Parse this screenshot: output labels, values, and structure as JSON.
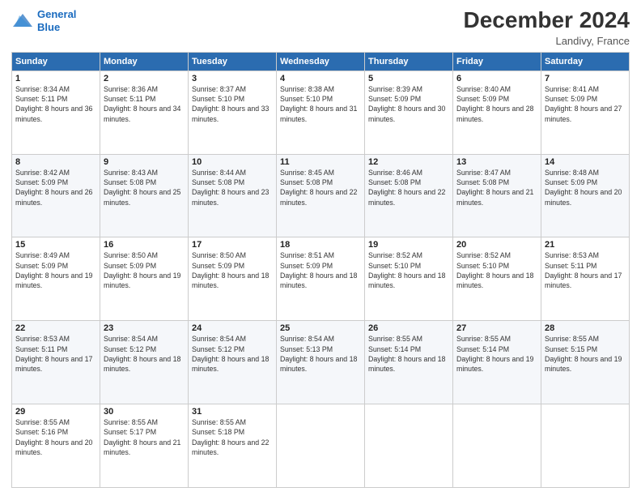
{
  "logo": {
    "line1": "General",
    "line2": "Blue"
  },
  "header": {
    "title": "December 2024",
    "subtitle": "Landivy, France"
  },
  "weekdays": [
    "Sunday",
    "Monday",
    "Tuesday",
    "Wednesday",
    "Thursday",
    "Friday",
    "Saturday"
  ],
  "weeks": [
    [
      {
        "day": "1",
        "sunrise": "8:34 AM",
        "sunset": "5:11 PM",
        "daylight": "8 hours and 36 minutes."
      },
      {
        "day": "2",
        "sunrise": "8:36 AM",
        "sunset": "5:11 PM",
        "daylight": "8 hours and 34 minutes."
      },
      {
        "day": "3",
        "sunrise": "8:37 AM",
        "sunset": "5:10 PM",
        "daylight": "8 hours and 33 minutes."
      },
      {
        "day": "4",
        "sunrise": "8:38 AM",
        "sunset": "5:10 PM",
        "daylight": "8 hours and 31 minutes."
      },
      {
        "day": "5",
        "sunrise": "8:39 AM",
        "sunset": "5:09 PM",
        "daylight": "8 hours and 30 minutes."
      },
      {
        "day": "6",
        "sunrise": "8:40 AM",
        "sunset": "5:09 PM",
        "daylight": "8 hours and 28 minutes."
      },
      {
        "day": "7",
        "sunrise": "8:41 AM",
        "sunset": "5:09 PM",
        "daylight": "8 hours and 27 minutes."
      }
    ],
    [
      {
        "day": "8",
        "sunrise": "8:42 AM",
        "sunset": "5:09 PM",
        "daylight": "8 hours and 26 minutes."
      },
      {
        "day": "9",
        "sunrise": "8:43 AM",
        "sunset": "5:08 PM",
        "daylight": "8 hours and 25 minutes."
      },
      {
        "day": "10",
        "sunrise": "8:44 AM",
        "sunset": "5:08 PM",
        "daylight": "8 hours and 23 minutes."
      },
      {
        "day": "11",
        "sunrise": "8:45 AM",
        "sunset": "5:08 PM",
        "daylight": "8 hours and 22 minutes."
      },
      {
        "day": "12",
        "sunrise": "8:46 AM",
        "sunset": "5:08 PM",
        "daylight": "8 hours and 22 minutes."
      },
      {
        "day": "13",
        "sunrise": "8:47 AM",
        "sunset": "5:08 PM",
        "daylight": "8 hours and 21 minutes."
      },
      {
        "day": "14",
        "sunrise": "8:48 AM",
        "sunset": "5:09 PM",
        "daylight": "8 hours and 20 minutes."
      }
    ],
    [
      {
        "day": "15",
        "sunrise": "8:49 AM",
        "sunset": "5:09 PM",
        "daylight": "8 hours and 19 minutes."
      },
      {
        "day": "16",
        "sunrise": "8:50 AM",
        "sunset": "5:09 PM",
        "daylight": "8 hours and 19 minutes."
      },
      {
        "day": "17",
        "sunrise": "8:50 AM",
        "sunset": "5:09 PM",
        "daylight": "8 hours and 18 minutes."
      },
      {
        "day": "18",
        "sunrise": "8:51 AM",
        "sunset": "5:09 PM",
        "daylight": "8 hours and 18 minutes."
      },
      {
        "day": "19",
        "sunrise": "8:52 AM",
        "sunset": "5:10 PM",
        "daylight": "8 hours and 18 minutes."
      },
      {
        "day": "20",
        "sunrise": "8:52 AM",
        "sunset": "5:10 PM",
        "daylight": "8 hours and 18 minutes."
      },
      {
        "day": "21",
        "sunrise": "8:53 AM",
        "sunset": "5:11 PM",
        "daylight": "8 hours and 17 minutes."
      }
    ],
    [
      {
        "day": "22",
        "sunrise": "8:53 AM",
        "sunset": "5:11 PM",
        "daylight": "8 hours and 17 minutes."
      },
      {
        "day": "23",
        "sunrise": "8:54 AM",
        "sunset": "5:12 PM",
        "daylight": "8 hours and 18 minutes."
      },
      {
        "day": "24",
        "sunrise": "8:54 AM",
        "sunset": "5:12 PM",
        "daylight": "8 hours and 18 minutes."
      },
      {
        "day": "25",
        "sunrise": "8:54 AM",
        "sunset": "5:13 PM",
        "daylight": "8 hours and 18 minutes."
      },
      {
        "day": "26",
        "sunrise": "8:55 AM",
        "sunset": "5:14 PM",
        "daylight": "8 hours and 18 minutes."
      },
      {
        "day": "27",
        "sunrise": "8:55 AM",
        "sunset": "5:14 PM",
        "daylight": "8 hours and 19 minutes."
      },
      {
        "day": "28",
        "sunrise": "8:55 AM",
        "sunset": "5:15 PM",
        "daylight": "8 hours and 19 minutes."
      }
    ],
    [
      {
        "day": "29",
        "sunrise": "8:55 AM",
        "sunset": "5:16 PM",
        "daylight": "8 hours and 20 minutes."
      },
      {
        "day": "30",
        "sunrise": "8:55 AM",
        "sunset": "5:17 PM",
        "daylight": "8 hours and 21 minutes."
      },
      {
        "day": "31",
        "sunrise": "8:55 AM",
        "sunset": "5:18 PM",
        "daylight": "8 hours and 22 minutes."
      },
      null,
      null,
      null,
      null
    ]
  ]
}
